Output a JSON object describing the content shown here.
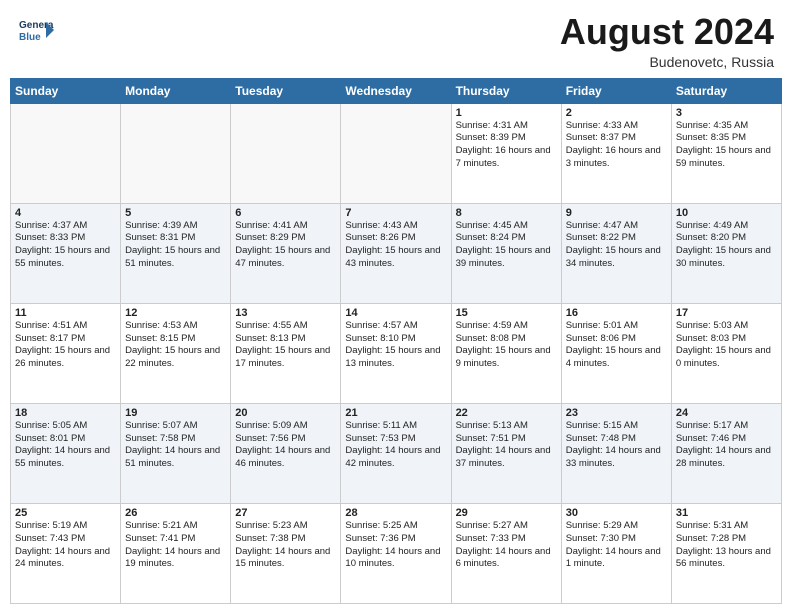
{
  "header": {
    "logo_line1": "General",
    "logo_line2": "Blue",
    "month_year": "August 2024",
    "location": "Budenovetc, Russia"
  },
  "days_of_week": [
    "Sunday",
    "Monday",
    "Tuesday",
    "Wednesday",
    "Thursday",
    "Friday",
    "Saturday"
  ],
  "weeks": [
    [
      {
        "num": "",
        "info": ""
      },
      {
        "num": "",
        "info": ""
      },
      {
        "num": "",
        "info": ""
      },
      {
        "num": "",
        "info": ""
      },
      {
        "num": "1",
        "info": "Sunrise: 4:31 AM\nSunset: 8:39 PM\nDaylight: 16 hours\nand 7 minutes."
      },
      {
        "num": "2",
        "info": "Sunrise: 4:33 AM\nSunset: 8:37 PM\nDaylight: 16 hours\nand 3 minutes."
      },
      {
        "num": "3",
        "info": "Sunrise: 4:35 AM\nSunset: 8:35 PM\nDaylight: 15 hours\nand 59 minutes."
      }
    ],
    [
      {
        "num": "4",
        "info": "Sunrise: 4:37 AM\nSunset: 8:33 PM\nDaylight: 15 hours\nand 55 minutes."
      },
      {
        "num": "5",
        "info": "Sunrise: 4:39 AM\nSunset: 8:31 PM\nDaylight: 15 hours\nand 51 minutes."
      },
      {
        "num": "6",
        "info": "Sunrise: 4:41 AM\nSunset: 8:29 PM\nDaylight: 15 hours\nand 47 minutes."
      },
      {
        "num": "7",
        "info": "Sunrise: 4:43 AM\nSunset: 8:26 PM\nDaylight: 15 hours\nand 43 minutes."
      },
      {
        "num": "8",
        "info": "Sunrise: 4:45 AM\nSunset: 8:24 PM\nDaylight: 15 hours\nand 39 minutes."
      },
      {
        "num": "9",
        "info": "Sunrise: 4:47 AM\nSunset: 8:22 PM\nDaylight: 15 hours\nand 34 minutes."
      },
      {
        "num": "10",
        "info": "Sunrise: 4:49 AM\nSunset: 8:20 PM\nDaylight: 15 hours\nand 30 minutes."
      }
    ],
    [
      {
        "num": "11",
        "info": "Sunrise: 4:51 AM\nSunset: 8:17 PM\nDaylight: 15 hours\nand 26 minutes."
      },
      {
        "num": "12",
        "info": "Sunrise: 4:53 AM\nSunset: 8:15 PM\nDaylight: 15 hours\nand 22 minutes."
      },
      {
        "num": "13",
        "info": "Sunrise: 4:55 AM\nSunset: 8:13 PM\nDaylight: 15 hours\nand 17 minutes."
      },
      {
        "num": "14",
        "info": "Sunrise: 4:57 AM\nSunset: 8:10 PM\nDaylight: 15 hours\nand 13 minutes."
      },
      {
        "num": "15",
        "info": "Sunrise: 4:59 AM\nSunset: 8:08 PM\nDaylight: 15 hours\nand 9 minutes."
      },
      {
        "num": "16",
        "info": "Sunrise: 5:01 AM\nSunset: 8:06 PM\nDaylight: 15 hours\nand 4 minutes."
      },
      {
        "num": "17",
        "info": "Sunrise: 5:03 AM\nSunset: 8:03 PM\nDaylight: 15 hours\nand 0 minutes."
      }
    ],
    [
      {
        "num": "18",
        "info": "Sunrise: 5:05 AM\nSunset: 8:01 PM\nDaylight: 14 hours\nand 55 minutes."
      },
      {
        "num": "19",
        "info": "Sunrise: 5:07 AM\nSunset: 7:58 PM\nDaylight: 14 hours\nand 51 minutes."
      },
      {
        "num": "20",
        "info": "Sunrise: 5:09 AM\nSunset: 7:56 PM\nDaylight: 14 hours\nand 46 minutes."
      },
      {
        "num": "21",
        "info": "Sunrise: 5:11 AM\nSunset: 7:53 PM\nDaylight: 14 hours\nand 42 minutes."
      },
      {
        "num": "22",
        "info": "Sunrise: 5:13 AM\nSunset: 7:51 PM\nDaylight: 14 hours\nand 37 minutes."
      },
      {
        "num": "23",
        "info": "Sunrise: 5:15 AM\nSunset: 7:48 PM\nDaylight: 14 hours\nand 33 minutes."
      },
      {
        "num": "24",
        "info": "Sunrise: 5:17 AM\nSunset: 7:46 PM\nDaylight: 14 hours\nand 28 minutes."
      }
    ],
    [
      {
        "num": "25",
        "info": "Sunrise: 5:19 AM\nSunset: 7:43 PM\nDaylight: 14 hours\nand 24 minutes."
      },
      {
        "num": "26",
        "info": "Sunrise: 5:21 AM\nSunset: 7:41 PM\nDaylight: 14 hours\nand 19 minutes."
      },
      {
        "num": "27",
        "info": "Sunrise: 5:23 AM\nSunset: 7:38 PM\nDaylight: 14 hours\nand 15 minutes."
      },
      {
        "num": "28",
        "info": "Sunrise: 5:25 AM\nSunset: 7:36 PM\nDaylight: 14 hours\nand 10 minutes."
      },
      {
        "num": "29",
        "info": "Sunrise: 5:27 AM\nSunset: 7:33 PM\nDaylight: 14 hours\nand 6 minutes."
      },
      {
        "num": "30",
        "info": "Sunrise: 5:29 AM\nSunset: 7:30 PM\nDaylight: 14 hours\nand 1 minute."
      },
      {
        "num": "31",
        "info": "Sunrise: 5:31 AM\nSunset: 7:28 PM\nDaylight: 13 hours\nand 56 minutes."
      }
    ]
  ]
}
